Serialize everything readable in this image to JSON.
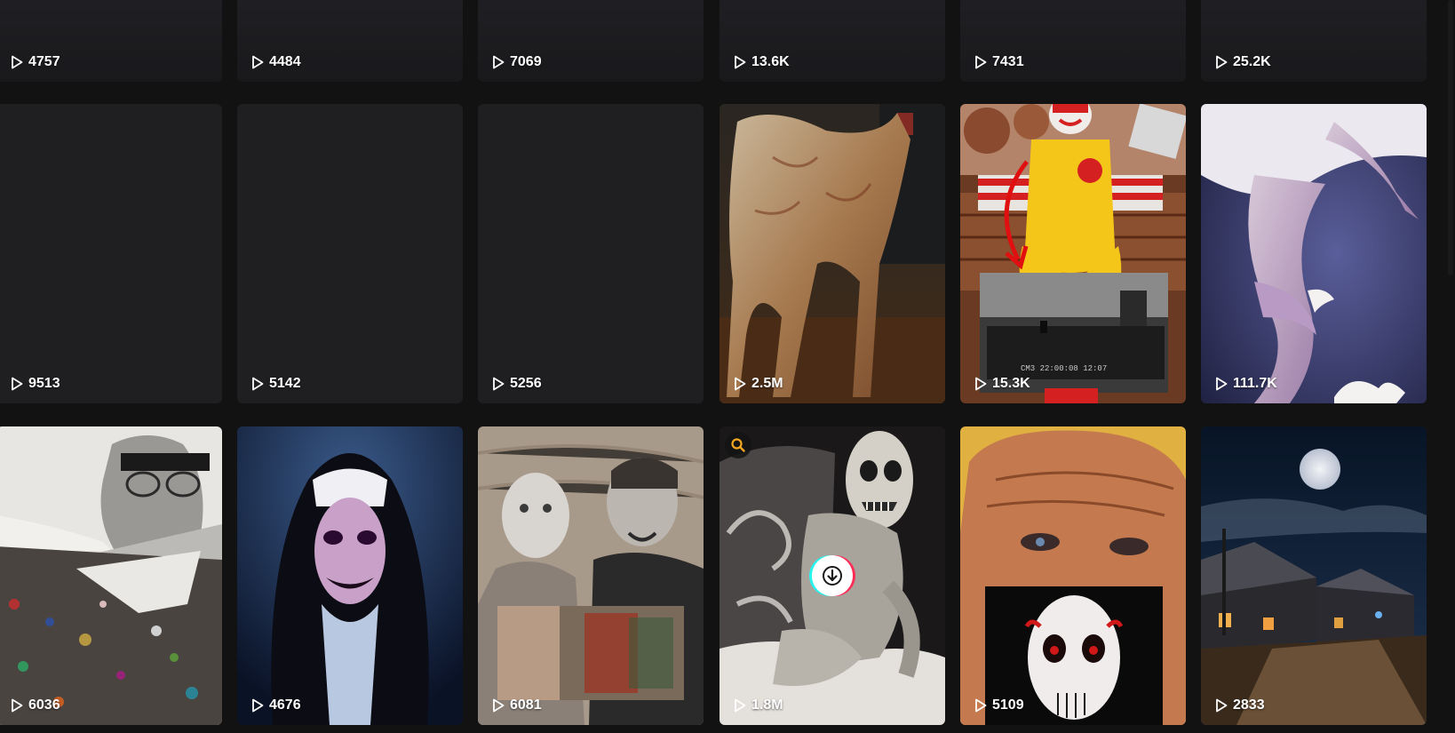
{
  "grid": {
    "row0": [
      {
        "views": "4757"
      },
      {
        "views": "4484"
      },
      {
        "views": "7069"
      },
      {
        "views": "13.6K"
      },
      {
        "views": "7431"
      },
      {
        "views": "25.2K"
      }
    ],
    "row1": [
      {
        "views": "9513"
      },
      {
        "views": "5142"
      },
      {
        "views": "5256"
      },
      {
        "views": "2.5M",
        "thumb": "pale-creature-photo"
      },
      {
        "views": "15.3K",
        "thumb": "clown-statue-with-cctv-inset",
        "inset_caption": "CM3 22:00:08 12:07"
      },
      {
        "views": "111.7K",
        "thumb": "pale-limbs-closeup"
      }
    ],
    "row2": [
      {
        "views": "6036",
        "thumb": "man-with-glasses-and-debris"
      },
      {
        "views": "4676",
        "thumb": "demon-nun"
      },
      {
        "views": "6081",
        "thumb": "two-people-with-blurred-photo"
      },
      {
        "views": "1.8M",
        "thumb": "gaunt-pale-figure"
      },
      {
        "views": "5109",
        "thumb": "old-man-with-puppet-mask"
      },
      {
        "views": "2833",
        "thumb": "moonlit-village-street"
      }
    ]
  },
  "icons": {
    "play": "play-icon",
    "search": "search-icon",
    "download": "download-icon"
  },
  "colors": {
    "background": "#121212",
    "card": "#1f1f22",
    "search_accent": "#f5a623",
    "brand_cyan": "#25f4ee",
    "brand_red": "#fe2c55"
  }
}
